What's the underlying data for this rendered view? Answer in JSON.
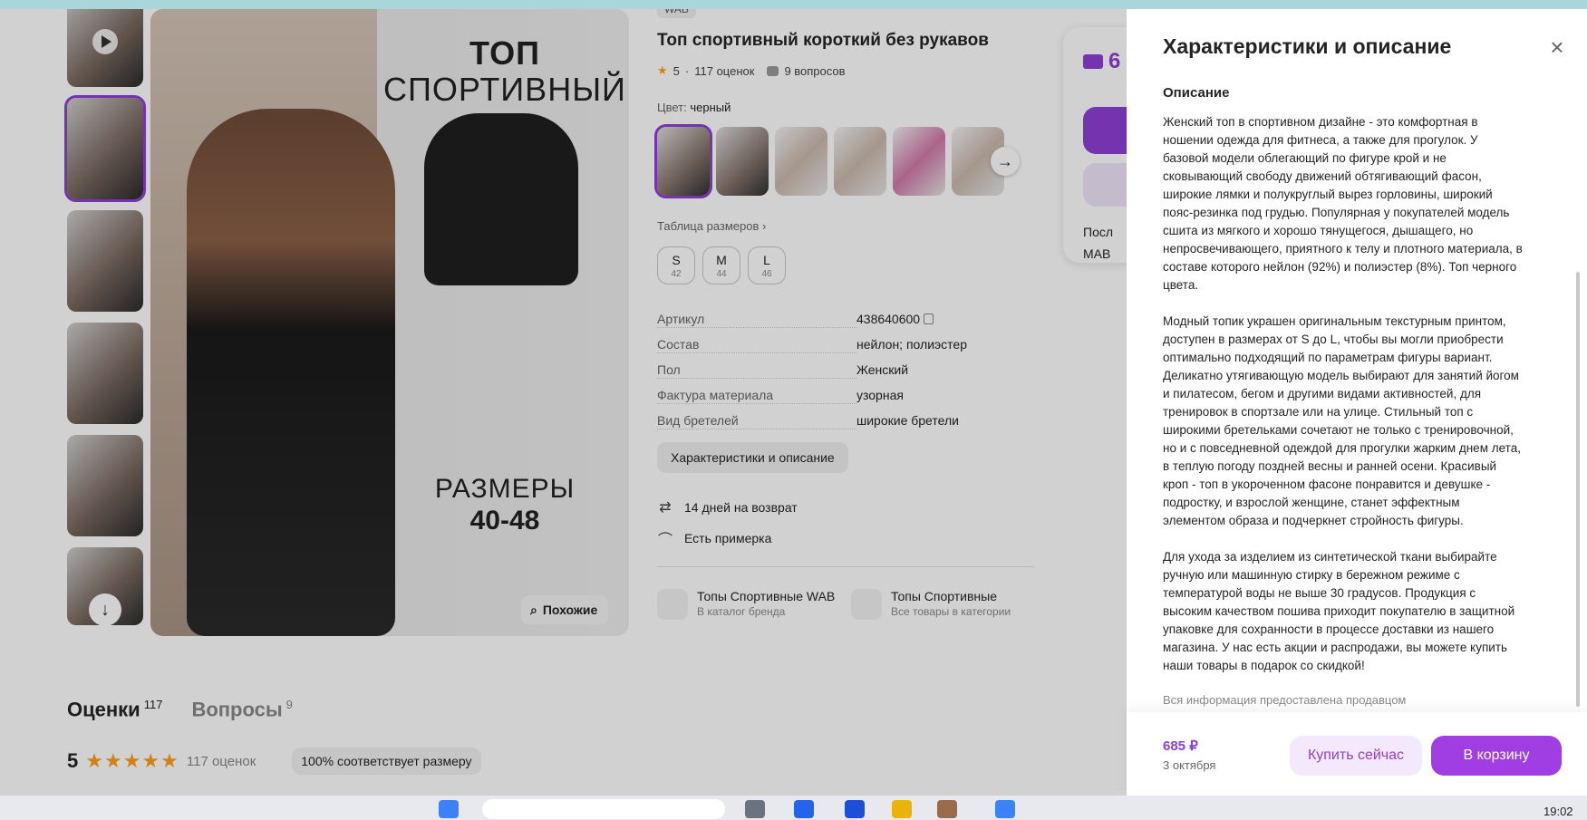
{
  "product": {
    "brand": "WAB",
    "title": "Топ спортивный короткий без рукавов",
    "rating": "5",
    "reviews": "117 оценок",
    "questions": "9 вопросов",
    "color_label": "Цвет:",
    "color_value": "черный",
    "size_table": "Таблица размеров",
    "sizes": [
      {
        "letter": "S",
        "num": "42"
      },
      {
        "letter": "M",
        "num": "44"
      },
      {
        "letter": "L",
        "num": "46"
      }
    ],
    "specs": [
      {
        "key": "Артикул",
        "value": "438640600"
      },
      {
        "key": "Состав",
        "value": "нейлон; полиэстер"
      },
      {
        "key": "Пол",
        "value": "Женский"
      },
      {
        "key": "Фактура материала",
        "value": "узорная"
      },
      {
        "key": "Вид бретелей",
        "value": "широкие бретели"
      }
    ],
    "char_button": "Характеристики и описание",
    "perks": [
      "14 дней на возврат",
      "Есть примерка"
    ],
    "categories": [
      {
        "title": "Топы Спортивные WAB",
        "sub": "В каталог бренда"
      },
      {
        "title": "Топы Спортивные",
        "sub": "Все товары в категории"
      }
    ],
    "photo_text": {
      "line1": "ТОП",
      "line2": "СПОРТИВНЫЙ",
      "sizes1": "РАЗМЕРЫ",
      "sizes2": "40-48"
    },
    "similar": "Похожие"
  },
  "price_card": {
    "price": "6",
    "line1": "Посл",
    "line2": "МАВ"
  },
  "bottom": {
    "tab_reviews": "Оценки",
    "tab_reviews_count": "117",
    "tab_questions": "Вопросы",
    "tab_questions_count": "9",
    "rating": "5",
    "stars": "★★★★★",
    "count": "117 оценок",
    "fit": "100% соответствует размеру"
  },
  "panel": {
    "title": "Характеристики и описание",
    "section": "Описание",
    "paragraphs": [
      "Женский топ в спортивном дизайне - это комфортная в ношении одежда для фитнеса, а также для прогулок. У базовой модели облегающий по фигуре крой и не сковывающий свободу движений обтягивающий фасон, широкие лямки и полукруглый вырез горловины, широкий пояс-резинка под грудью. Популярная у покупателей модель сшита из мягкого и хорошо тянущегося, дышащего, но непросвечивающего, приятного к телу и плотного материала, в составе которого нейлон (92%) и полиэстер (8%). Топ черного цвета.",
      "Модный топик украшен оригинальным текстурным принтом, доступен в размерах от S до L, чтобы вы могли приобрести оптимально подходящий по параметрам фигуры вариант. Деликатно утягивающую модель выбирают для занятий йогом и пилатесом, бегом и другими видами активностей, для тренировок в спортзале или на улице. Стильный топ с широкими бретельками сочетают не только с тренировочной, но и с повседневной одеждой для прогулки жарким днем лета, в теплую погоду поздней весны и ранней осени. Красивый кроп - топ в укороченном фасоне понравится и девушке - подростку, и взрослой женщине, станет эффектным элементом образа и подчеркнет стройность фигуры.",
      "Для ухода за изделием из синтетической ткани выбирайте ручную или машинную стирку в бережном режиме с температурой воды не выше 30 градусов. Продукция с высоким качеством пошива приходит покупателю в защитной упаковке для сохранности в процессе доставки из нашего магазина. У нас есть акции и распродажи, вы можете купить наши товары в подарок со скидкой!"
    ],
    "seller_note": "Вся информация предоставлена продавцом",
    "price": "685 ₽",
    "date": "3 октября",
    "buy_now": "Купить сейчас",
    "to_cart": "В корзину",
    "close_icon": "×"
  },
  "taskbar": {
    "clock": "19:02"
  },
  "colors": {
    "accent": "#8e3fd6",
    "cart": "#a03de3",
    "star": "#ff9f1c"
  }
}
